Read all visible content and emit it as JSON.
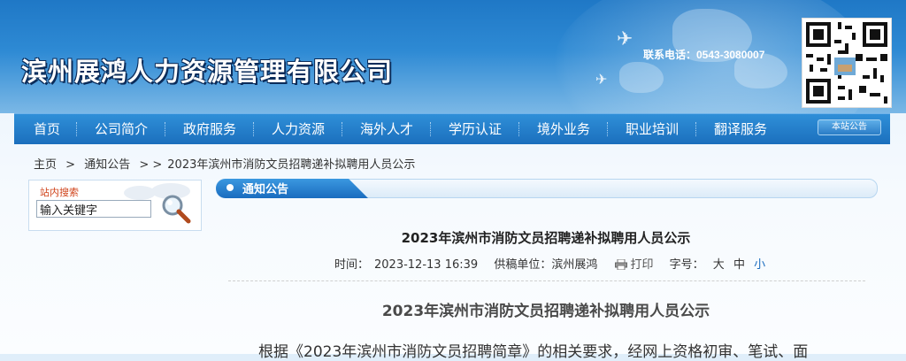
{
  "header": {
    "site_name": "滨州展鸿人力资源管理有限公司",
    "hotline": "联系电话：0543-3080007"
  },
  "nav": {
    "items": [
      {
        "label": "首页"
      },
      {
        "label": "公司简介"
      },
      {
        "label": "政府服务"
      },
      {
        "label": "人力资源"
      },
      {
        "label": "海外人才"
      },
      {
        "label": "学历认证"
      },
      {
        "label": "境外业务"
      },
      {
        "label": "职业培训"
      },
      {
        "label": "翻译服务"
      }
    ],
    "notice_button": "本站公告"
  },
  "breadcrumb": {
    "home": "主页",
    "sep1": ">",
    "section": "通知公告",
    "sep2": "> >",
    "current": "2023年滨州市消防文员招聘递补拟聘用人员公示"
  },
  "search": {
    "title": "站内搜索",
    "input_value": "输入关键字"
  },
  "section": {
    "label": "通知公告"
  },
  "article": {
    "title": "2023年滨州市消防文员招聘递补拟聘用人员公示",
    "meta": {
      "time_label": "时间：",
      "time_value": "2023-12-13 16:39",
      "source_label": "供稿单位：",
      "source_value": "滨州展鸿",
      "print_label": "打印",
      "font_label": "字号：",
      "font_large": "大",
      "font_medium": "中",
      "font_small": "小"
    },
    "body_title": "2023年滨州市消防文员招聘递补拟聘用人员公示",
    "body_first_line": "根据《2023年滨州市消防文员招聘简章》的相关要求，经网上资格初审、笔试、面"
  },
  "colors": {
    "nav_bg": "#1f78c6",
    "accent_red": "#d0441c",
    "link_blue": "#1a6cbf"
  }
}
